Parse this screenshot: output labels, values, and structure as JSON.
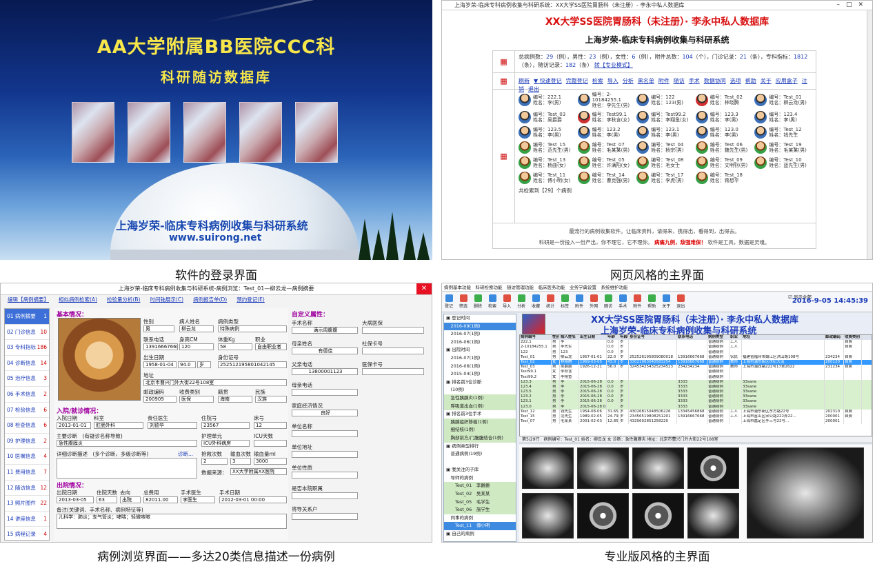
{
  "captions": {
    "login": "软件的登录界面",
    "web": "网页风格的主界面",
    "browse": "病例浏览界面——多达20类信息描述一份病例",
    "pro": "专业版风格的主界面"
  },
  "login": {
    "title": "AA大学附属BB医院CCC科",
    "subtitle": "科研随访数据库",
    "system": "上海岁荣-临床专科病例收集与科研系统",
    "url": "www.suirong.net"
  },
  "web": {
    "window_title": "上海岁荣-临床专科病例收集与科研系统：XX大学SS医院胃肠科（未注册）- 李永中私人数据库",
    "title": "XX大学SS医院胃肠科（未注册）· 李永中私人数据库",
    "subtitle": "上海岁荣-临床专科病例收集与科研系统",
    "stats": {
      "total_cases": "29",
      "male": "23",
      "female": "6",
      "attachments": "104",
      "outpatient": "21",
      "indicators": "1812",
      "followups": "182",
      "line1_a": "总病例数：",
      "line1_b": "（例），男性：",
      "line1_c": "（例），女性：",
      "line1_d": "（例），附件总数：",
      "line1_e": "（个），门诊记录：",
      "line1_f": "（条），专科指标：",
      "line2_a": "（条），随访记录：",
      "line2_b": "（条）",
      "mode_link": "转【专业模式】"
    },
    "links": [
      "刷新",
      "▼ 快速登记",
      "完整登记",
      "检索",
      "导入",
      "分析",
      "黑名单",
      "附件",
      "随访",
      "手术",
      "数据协同",
      "选项",
      "帮助",
      "关于",
      "应用盒子",
      "注销",
      "退出"
    ],
    "patients": [
      {
        "id": "编号：222.1",
        "name": "姓名：李(男)",
        "g": "m"
      },
      {
        "id": "编号：2-10184255.1",
        "name": "姓名：李先生(男)",
        "g": "m"
      },
      {
        "id": "编号：122",
        "name": "姓名：123(男)",
        "g": "m"
      },
      {
        "id": "编号：Test_02",
        "name": "姓名：林晓腾",
        "g": "r"
      },
      {
        "id": "编号：Test_01",
        "name": "姓名：柳云龙(男)",
        "g": "m"
      },
      {
        "id": "编号：Test_03",
        "name": "姓名：吴爵爵",
        "g": "m"
      },
      {
        "id": "编号：Test99.1",
        "name": "姓名：李秋含(女)",
        "g": "r"
      },
      {
        "id": "编号：Test99.2",
        "name": "姓名：李翔鱼(女)",
        "g": "m"
      },
      {
        "id": "编号：123.3",
        "name": "姓名：李(男)",
        "g": "m"
      },
      {
        "id": "编号：123.4",
        "name": "姓名：李(男)",
        "g": "m"
      },
      {
        "id": "编号：123.5",
        "name": "姓名：李(男)",
        "g": "m"
      },
      {
        "id": "编号：123.2",
        "name": "姓名：李(男)",
        "g": "m"
      },
      {
        "id": "编号：123.1",
        "name": "姓名：李(男)",
        "g": "m"
      },
      {
        "id": "编号：123.0",
        "name": "姓名：李(男)",
        "g": "m"
      },
      {
        "id": "编号：Test_12",
        "name": "姓名：钱先生",
        "g": "m"
      },
      {
        "id": "编号：Test_15",
        "name": "姓名：范先生(男)",
        "g": "f"
      },
      {
        "id": "编号：Test_07",
        "name": "姓名：毛某某(男)",
        "g": "f"
      },
      {
        "id": "编号：Test_04",
        "name": "姓名：杨宗(男)",
        "g": "m"
      },
      {
        "id": "编号：Test_06",
        "name": "姓名：魏先生(男)",
        "g": "f"
      },
      {
        "id": "编号：Test_19",
        "name": "姓名：毛某某(男)",
        "g": "f"
      },
      {
        "id": "编号：Test_13",
        "name": "姓名：杨曲(女)",
        "g": "f"
      },
      {
        "id": "编号：Test_05",
        "name": "姓名：许满阳(女)",
        "g": "f"
      },
      {
        "id": "编号：Test_08",
        "name": "姓名：毛女士",
        "g": "f"
      },
      {
        "id": "编号：Test_09",
        "name": "姓名：文明钊(男)",
        "g": "f"
      },
      {
        "id": "编号：Test_10",
        "name": "姓名：蓝先生(男)",
        "g": "f"
      },
      {
        "id": "编号：Test_11",
        "name": "姓名：傅小明(女)",
        "g": "f"
      },
      {
        "id": "编号：Test_14",
        "name": "姓名：曹克强(男)",
        "g": "f"
      },
      {
        "id": "编号：Test_17",
        "name": "姓名：李虎(男)",
        "g": "f"
      },
      {
        "id": "编号：Test_18",
        "name": "姓名：蒋想平",
        "g": "f"
      }
    ],
    "search_result": "共检索到【29】个病例",
    "foot1": "最流行的病例收集软件。让临床资料，请得来，携得出，看得到，出得去。",
    "foot2a": "科研是一份投入一份产出，你不理它，它不理你。",
    "foot2b": "病痛九例，敌强难保！",
    "foot2c": "软件是工具，数据是灵魂。"
  },
  "browse": {
    "window_title": "上海岁荣-临床专科病例收集与科研系统-病例浏览：Test_01—柳云龙—病例摘要",
    "tabs": [
      "编辑【病例摘要】",
      "相似病例检索(A)",
      "检验量分析(B)",
      "时间轴展示(C)",
      "病例报告单(D)",
      "预约登记(E)"
    ],
    "side": [
      {
        "label": "01 病例摘要",
        "n": "1"
      },
      {
        "label": "02 门诊信息",
        "n": "10"
      },
      {
        "label": "03 专科指标",
        "n": "186"
      },
      {
        "label": "04 诊断信息",
        "n": "14"
      },
      {
        "label": "05 治疗信息",
        "n": "3"
      },
      {
        "label": "06 手术信息",
        "n": "2"
      },
      {
        "label": "07 检验信息",
        "n": "6"
      },
      {
        "label": "08 检查信息",
        "n": "6"
      },
      {
        "label": "09 护理信息",
        "n": "2"
      },
      {
        "label": "10 医嘱信息",
        "n": "4"
      },
      {
        "label": "11 费用信息",
        "n": "7"
      },
      {
        "label": "12 随访信息",
        "n": "12"
      },
      {
        "label": "13 照片图件",
        "n": "22"
      },
      {
        "label": "14 讲座信息",
        "n": "1"
      },
      {
        "label": "15 病程记录",
        "n": "4"
      },
      {
        "label": "16 科研观察",
        "n": "2"
      },
      {
        "label": "17 监测信息",
        "n": "6"
      },
      {
        "label": "18 其他信息",
        "n": "4"
      }
    ],
    "basic_title": "基本情况：",
    "f": {
      "gender_l": "性别",
      "gender": "男",
      "name_l": "病人姓名",
      "name": "柳云龙",
      "type_l": "病例类型",
      "type": "特殊病例",
      "phone_l": "联系电话",
      "phone": "13916667668",
      "height_l": "身高CM",
      "height": "120",
      "weight_l": "体重Kg",
      "weight": "58",
      "job_l": "职业",
      "job": "自由职业者",
      "birth_l": "出生日期",
      "birth": "1958-01-04",
      "age": "94.0",
      "unit": "岁",
      "id_l": "身份证号",
      "id": "252512195801042145",
      "addr_l": "地址",
      "addr": "北京市曹兴门外大街22号108室",
      "zip_l": "邮政编码",
      "zip": "200909",
      "ins_l": "收费类别",
      "ins": "医保",
      "nation_l": "籍贯",
      "nation": "海南",
      "ethnic_l": "民族",
      "ethnic": "汉族"
    },
    "admit_title": "入院/就诊情况：",
    "a": {
      "date_l": "入院日期",
      "date": "2013-01-01",
      "dept_l": "科室",
      "dept": "肛肠外科",
      "doc_l": "责任医生",
      "doc": "刘德华",
      "no_l": "住院号",
      "no": "23567",
      "bed_l": "床号",
      "bed": "12",
      "diag_l": "主要诊断　(有疑诊名称导致)",
      "diag": "急性腹膜炎",
      "unit_l": "护理单元",
      "unit": "ICU外科病房",
      "icu_l": "ICU天数",
      "detail_l": "详细诊断描述　(多个诊断，多级诊断等)",
      "detail_btn": "诊断...",
      "rescue_l": "抢救次数",
      "rescue": "2",
      "trans_l": "输血次数",
      "trans": "3",
      "blood_l": "输血量ml",
      "blood": "3000",
      "source_l": "数据来源：",
      "source": "XX大学附属XX医院"
    },
    "dis_title": "出院情况：",
    "d": {
      "date_l": "出院日期",
      "date": "2013-03-05",
      "days_l": "住院天数",
      "days": "63",
      "out_l": "去向",
      "out": "出院",
      "fee_l": "总费用",
      "fee": "82011.00",
      "sdoc_l": "手术医生",
      "sdoc": "李医生",
      "sdate_l": "手术日期",
      "sdate": "2012-03-01 00:00",
      "note_l": "备注(关键词、手术名称、病例特征等)",
      "note": "儿科学：肺炎；支气管炎；哮喘；轻微咳嗽"
    },
    "custom_title": "自定义属性：",
    "r": [
      {
        "l": "手术名称",
        "v": "满示周腹腹",
        "l2": "大病医保"
      },
      {
        "l": "母亲姓名",
        "v": "有德佳",
        "l2": "社保卡号"
      },
      {
        "l": "父亲电话",
        "v": "13800001123",
        "l2": "医保卡号"
      },
      {
        "l": "母亲电话",
        "v": "",
        "l2": ""
      },
      {
        "l": "家庭经济情况",
        "v": "良好",
        "l2": ""
      },
      {
        "l": "单位名称",
        "v": "",
        "l2": ""
      },
      {
        "l": "单位地址",
        "v": "",
        "l2": ""
      },
      {
        "l": "单位性质",
        "v": "",
        "l2": ""
      },
      {
        "l": "是否本院职属",
        "v": "",
        "l2": ""
      },
      {
        "l": "将导关系户",
        "v": "",
        "l2": ""
      }
    ]
  },
  "pro": {
    "menu": "病例基本功能　科研检索功能　随访管理功能　临床医务功能　业务学典设置　系统维护功能",
    "tools": [
      "登记",
      "筛选",
      "删除",
      "检索",
      "导入",
      "分析",
      "收藏",
      "统计",
      "标签",
      "附件",
      "外网",
      "随访",
      "手术",
      "附件",
      "帮助",
      "关于",
      "退出"
    ],
    "date": "2016-9-05 14:45:39",
    "chk1": "显示全部",
    "title1": "XX大学SS医院胃肠科（未注册）· 李永中私人数据库",
    "title2": "上海岁荣-临床专科病例收集与科研系统",
    "tree": [
      {
        "t": "▣ 登记时间",
        "c": ""
      },
      {
        "t": "　2016-09(1例)",
        "c": "hl"
      },
      {
        "t": "　2016-07(1例)",
        "c": ""
      },
      {
        "t": "　2016-06(1例)",
        "c": ""
      },
      {
        "t": "▣ 出院时间",
        "c": ""
      },
      {
        "t": "　2016-07(1例)",
        "c": ""
      },
      {
        "t": "　2016-06(1例)",
        "c": ""
      },
      {
        "t": "　2015-04(1例)",
        "c": ""
      },
      {
        "t": "▣ 排名前3位诊断",
        "c": ""
      },
      {
        "t": "　(10例)",
        "c": ""
      },
      {
        "t": "　急性胰腺炎(1例)",
        "c": "grn"
      },
      {
        "t": "　呼吸道出血(1例)",
        "c": "grn"
      },
      {
        "t": "▣ 排名前3位手术",
        "c": ""
      },
      {
        "t": "　胰腺组织移植(1例)",
        "c": "grn"
      },
      {
        "t": "　细结核(1例)",
        "c": "grn"
      },
      {
        "t": "　胸部前方/门腹腹结合(1例)",
        "c": "grn"
      },
      {
        "t": "▣ 病例类型排行",
        "c": ""
      },
      {
        "t": "　普通病例(19例)",
        "c": ""
      },
      {
        "t": "",
        "c": ""
      },
      {
        "t": "▣ 我关注的子库",
        "c": ""
      },
      {
        "t": "　导师的病例",
        "c": ""
      },
      {
        "t": "　　Test_01　李爵爵",
        "c": "grn"
      },
      {
        "t": "　　Test_02　吴某某",
        "c": "grn"
      },
      {
        "t": "　　Test_05　毛学生",
        "c": "grn"
      },
      {
        "t": "　　Test_06　施学生",
        "c": "grn"
      },
      {
        "t": "　同事的病例",
        "c": ""
      },
      {
        "t": "　　Test_11　傅小明",
        "c": "hl"
      },
      {
        "t": "▣ 自己的病例",
        "c": ""
      }
    ],
    "headers": [
      "病例编号",
      "性别",
      "病人姓名",
      "出生日期",
      "年龄",
      "年龄单",
      "身份证号",
      "联系电话",
      "病例类型",
      "职业",
      "地址",
      "邮政编码",
      "收费类别"
    ],
    "rows": [
      {
        "c": "",
        "v": [
          "222.1",
          "男",
          "李",
          "",
          "0.0",
          "岁",
          "",
          "",
          "普通病例",
          "工人",
          "",
          "",
          "自费"
        ]
      },
      {
        "c": "",
        "v": [
          "2-10184255.1",
          "男",
          "李先生",
          "",
          "0.0",
          "岁",
          "",
          "",
          "普通病例",
          "工人",
          "",
          "",
          "自费"
        ]
      },
      {
        "c": "",
        "v": [
          "122",
          "男",
          "123",
          "",
          "0.0",
          "岁",
          "",
          "",
          "普通病例",
          "",
          "",
          "",
          ""
        ]
      },
      {
        "c": "",
        "v": [
          "Test_01",
          "男",
          "柳云龙",
          "1957-01-01",
          "22.0",
          "岁",
          "252526195809080018",
          "13916667668",
          "普通病例",
          "农民",
          "福建省福州市鼓江区洪山路108号",
          "234234",
          "自费"
        ]
      },
      {
        "c": "sel",
        "v": [
          "Test_02",
          "女",
          "林晓腾",
          "1969-03-05",
          "43.0",
          "岁",
          "33021963040583254",
          "13916667668",
          "普通病例",
          "教师",
          "上海市浦东新区世纪大道",
          "200120",
          "自费"
        ]
      },
      {
        "c": "",
        "v": [
          "Test_03",
          "男",
          "吴爵爵",
          "1926-12-21",
          "56.0",
          "岁",
          "324534254325234523",
          "234234234",
          "普通病例",
          "教师",
          "上海市浦西路222号17室2622",
          "231234",
          "自费"
        ]
      },
      {
        "c": "",
        "v": [
          "Test99.1",
          "女",
          "李秋含",
          "",
          "",
          "",
          "",
          "",
          "普通病例",
          "",
          "",
          "",
          ""
        ]
      },
      {
        "c": "",
        "v": [
          "Test99.2",
          "女",
          "李翔鱼",
          "",
          "",
          "",
          "",
          "",
          "普通病例",
          "",
          "",
          "",
          ""
        ]
      },
      {
        "c": "g",
        "v": [
          "123.3",
          "男",
          "李",
          "2015-06-28",
          "0.0",
          "岁",
          "",
          "3333",
          "普通病例",
          "",
          "33sane",
          "",
          ""
        ]
      },
      {
        "c": "g",
        "v": [
          "123.4",
          "男",
          "李",
          "2015-06-28",
          "0.0",
          "岁",
          "",
          "3333",
          "普通病例",
          "",
          "33sane",
          "",
          ""
        ]
      },
      {
        "c": "g",
        "v": [
          "123.5",
          "男",
          "李",
          "2015-06-28",
          "0.0",
          "岁",
          "",
          "3333",
          "普通病例",
          "",
          "33sane",
          "",
          ""
        ]
      },
      {
        "c": "g",
        "v": [
          "123.2",
          "男",
          "李",
          "2015-06-28",
          "0.0",
          "岁",
          "",
          "3333",
          "普通病例",
          "",
          "33sane",
          "",
          ""
        ]
      },
      {
        "c": "g",
        "v": [
          "123.1",
          "男",
          "李",
          "2015-06-28",
          "0.0",
          "岁",
          "",
          "3333",
          "普通病例",
          "",
          "33sane",
          "",
          ""
        ]
      },
      {
        "c": "g",
        "v": [
          "123.0",
          "男",
          "李",
          "2015-06-28 0.02658",
          "",
          "岁",
          "",
          "3333",
          "普通病例",
          "",
          "33sane",
          "",
          ""
        ]
      },
      {
        "c": "",
        "v": [
          "Test_12",
          "男",
          "钱先生",
          "1954-08-06",
          "31.65",
          "岁",
          "43026815048506226",
          "13345456868",
          "普通病例",
          "工人",
          "上海市浦东新区东方路22号",
          "202310",
          "自费"
        ]
      },
      {
        "c": "",
        "v": [
          "Test_15",
          "男",
          "范先生",
          "1989-02-05",
          "24.79",
          "岁",
          "23456519808251201",
          "13916667668",
          "普通病例",
          "工人",
          "上海市富山区宋公路222弄22...",
          "200001",
          "自费"
        ]
      },
      {
        "c": "",
        "v": [
          "Test_07",
          "男",
          "毛某某",
          "2001-02-03",
          "12.85",
          "岁",
          "4320602851258220",
          "",
          "普通病例",
          "",
          "上海市嘉定区李三号22号...",
          "200001",
          ""
        ]
      }
    ],
    "status": "第5/29行　病例编号：Test_01 姓名：柳云龙 女 诊断：急性腹膜炎 地址：北京市曹兴门外大街22号108室"
  }
}
